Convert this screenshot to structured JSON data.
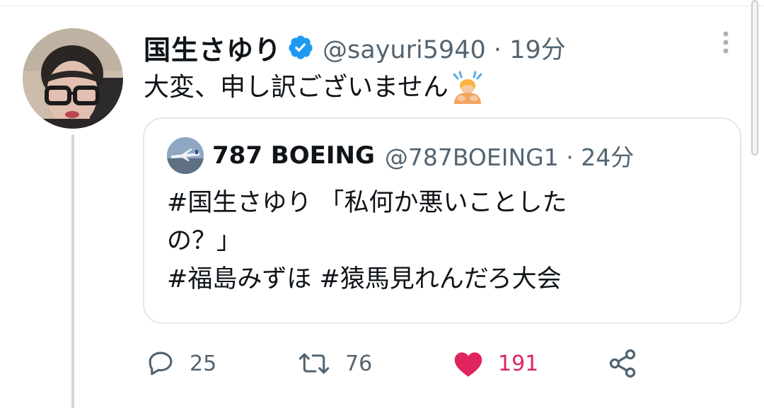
{
  "tweet": {
    "display_name": "国生さゆり",
    "handle": "@sayuri5940",
    "separator": "·",
    "time": "19分",
    "text": "大変、申し訳ございません",
    "verified": true
  },
  "quote": {
    "display_name": "787 BOEING",
    "handle": "@787BOEING1",
    "separator": "·",
    "time": "24分",
    "lines": [
      "#国生さゆり 「私何か悪いことした",
      "の？」",
      "#福島みずほ #猿馬見れんだろ大会"
    ]
  },
  "actions": {
    "reply_count": "25",
    "retweet_count": "76",
    "like_count": "191"
  },
  "colors": {
    "verified_blue": "#1d9bf0",
    "like_pink": "#e0245e",
    "meta_gray": "#536471"
  },
  "icons": {
    "reply": "reply-icon",
    "retweet": "retweet-icon",
    "like": "heart-icon",
    "share": "share-icon",
    "more": "more-vertical-icon",
    "verified": "verified-badge-icon",
    "emoji": "person-bowing-emoji-icon"
  }
}
